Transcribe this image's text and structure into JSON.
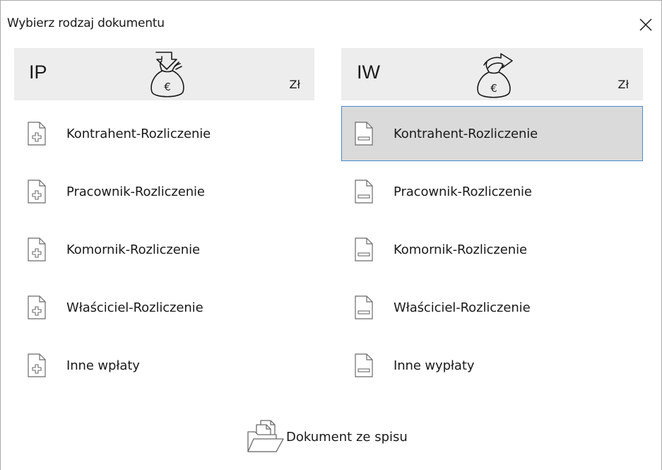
{
  "window": {
    "title": "Wybierz rodzaj dokumentu"
  },
  "columns": {
    "income": {
      "code": "IP",
      "currency": "Zł",
      "icon": "money-bag-in-icon",
      "items": [
        {
          "label": "Kontrahent-Rozliczenie"
        },
        {
          "label": "Pracownik-Rozliczenie"
        },
        {
          "label": "Komornik-Rozliczenie"
        },
        {
          "label": "Właściciel-Rozliczenie"
        },
        {
          "label": "Inne wpłaty"
        }
      ]
    },
    "expense": {
      "code": "IW",
      "currency": "Zł",
      "icon": "money-bag-out-icon",
      "items": [
        {
          "label": "Kontrahent-Rozliczenie",
          "selected": true
        },
        {
          "label": "Pracownik-Rozliczenie"
        },
        {
          "label": "Komornik-Rozliczenie"
        },
        {
          "label": "Właściciel-Rozliczenie"
        },
        {
          "label": "Inne wypłaty"
        }
      ]
    }
  },
  "footer": {
    "from_list_label": "Dokument ze spisu"
  },
  "colors": {
    "header_bg": "#ededed",
    "selected_bg": "#dadada",
    "selected_border": "#4b8ac9"
  }
}
